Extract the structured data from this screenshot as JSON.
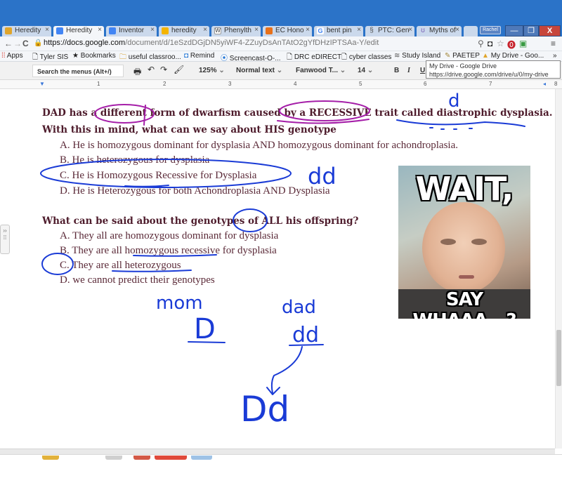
{
  "browser": {
    "tabs": [
      {
        "label": "Heredity",
        "color": "#e0a52b",
        "active": false
      },
      {
        "label": "Heredity",
        "color": "#4285f4",
        "active": true
      },
      {
        "label": "Inventor",
        "color": "#4285f4",
        "active": false
      },
      {
        "label": "heredity",
        "color": "#f4b400",
        "active": false
      },
      {
        "label": "Phenylth",
        "color": "#666666",
        "active": false
      },
      {
        "label": "EC Hono",
        "color": "#e8711a",
        "active": false
      },
      {
        "label": "bent pin",
        "color": "#4285f4",
        "active": false
      },
      {
        "label": "PTC: Gen",
        "color": "#555555",
        "active": false
      },
      {
        "label": "Myths of",
        "color": "#7a5fb5",
        "active": false
      }
    ],
    "profile_label": "Rachel",
    "window_controls": {
      "minimize": "—",
      "restore": "❐",
      "close": "X"
    },
    "url": {
      "host": "https://docs.google.com",
      "path": "/document/d/1eSzdDGjDN5yiWF4-ZZuyDsAnTAtO2gYfDHzIPTSAa-Y/edit"
    },
    "bookmarks": [
      "Apps",
      "Tyler SIS",
      "Bookmarks",
      "useful classroo...",
      "Remind",
      "Screencast-O-...",
      "DRC eDIRECT",
      "cyber classes",
      "Study Island",
      "PAETEP",
      "My Drive - Goo..."
    ],
    "tooltip": {
      "title": "My Drive - Google Drive",
      "url": "https://drive.google.com/drive/u/0/my-drive"
    }
  },
  "docs_toolbar": {
    "search_placeholder": "Search the menus (Alt+/)",
    "zoom": "125%",
    "style": "Normal text",
    "font": "Fanwood T...",
    "size": "14",
    "bold": "B",
    "italic": "I",
    "underline": "U"
  },
  "ruler": [
    "1",
    "2",
    "3",
    "4",
    "5",
    "6",
    "7",
    "8"
  ],
  "document": {
    "q1_line1": "DAD has a different form of dwarfism caused by a RECESSIVE trait called diastrophic dysplasia.",
    "q1_line2": "With this in mind, what can we say about HIS genotype",
    "q1_options": [
      "A.  He is homozygous dominant for dysplasia AND homozygous dominant for achondroplasia.",
      "B.  He is heterozygous for dysplasia",
      "C.  He is Homozygous Recessive for Dysplasia",
      "D.  He is Heterozygous for both Achondroplasia AND Dysplasia"
    ],
    "q2": "What can be said about the genotypes of ALL his offspring?",
    "q2_options": [
      "A.  They all are homozygous dominant for dysplasia",
      "B.  They are all homozygous recessive for dysplasia",
      "C.  They are all heterozygous",
      "D.  we cannot predict their genotypes"
    ]
  },
  "annotations": {
    "over_diastrophic": "d",
    "next_to_c": "dd",
    "mom_label": "mom",
    "mom_genotype": "D",
    "dad_label": "dad",
    "dad_genotype": "dd",
    "offspring_genotype": "Dd",
    "ink_blue": "#1a3bd6",
    "ink_purple": "#a51ea8"
  },
  "meme": {
    "top": "WAIT,",
    "bottom": "SAY WHAAA...?"
  }
}
